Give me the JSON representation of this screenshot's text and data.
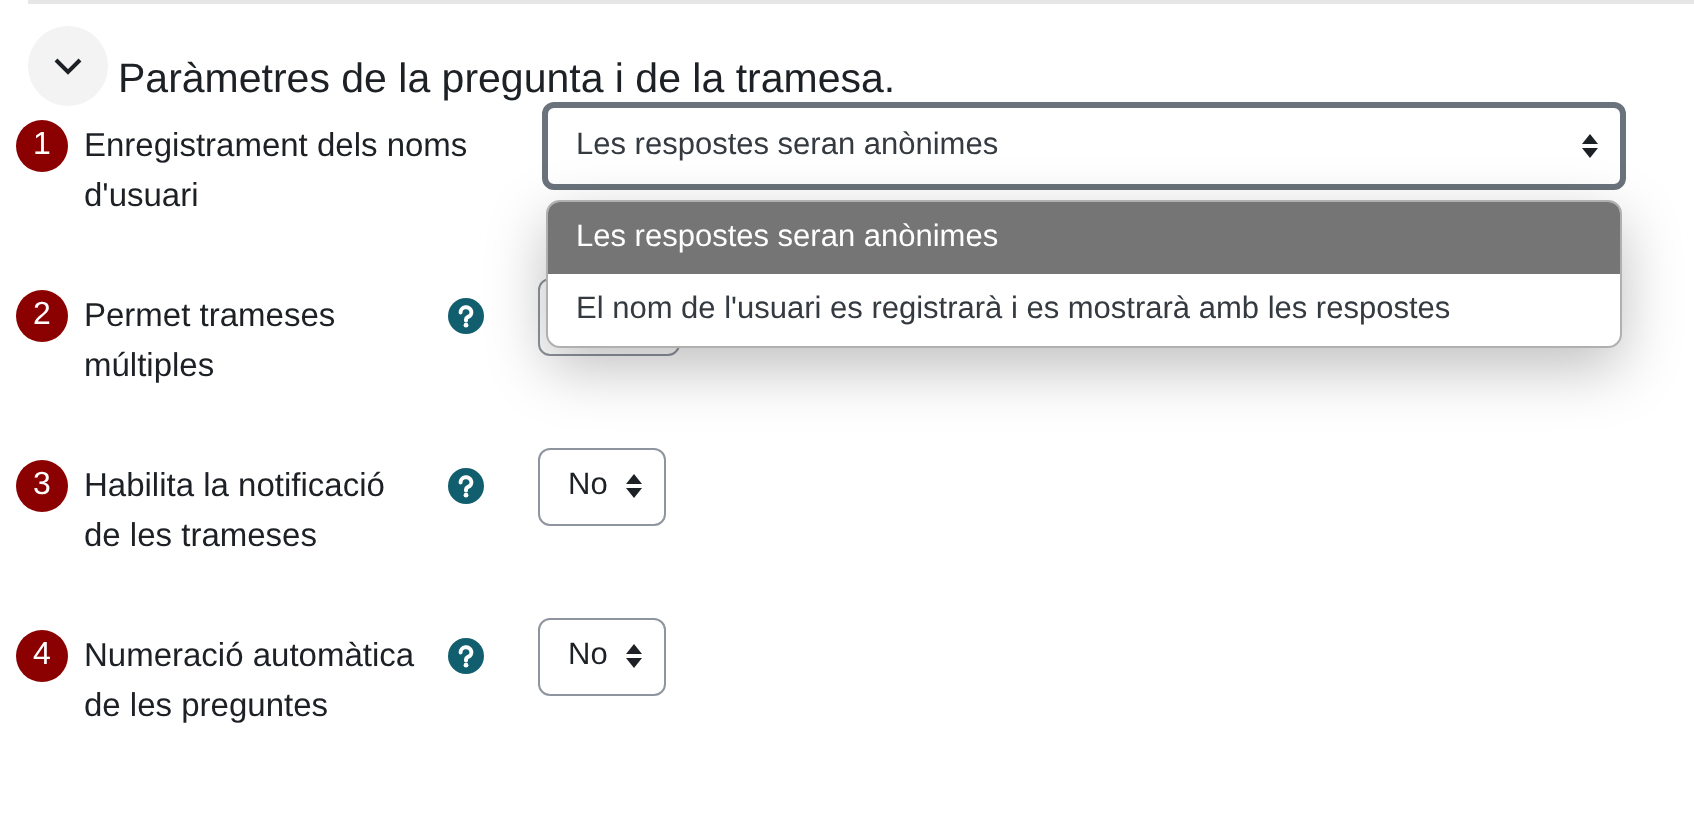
{
  "section": {
    "title": "Paràmetres de la pregunta i de la tramesa.",
    "expanded": true
  },
  "settings": [
    {
      "number": "1",
      "label": "Enregistrament dels noms d'usuari",
      "help": false,
      "focused": true,
      "value": "Les respostes seran anònimes",
      "open": true,
      "options": [
        {
          "label": "Les respostes seran anònimes",
          "selected": true
        },
        {
          "label": "El nom de l'usuari es registrarà i es mostrarà amb les respostes",
          "selected": false
        }
      ]
    },
    {
      "number": "2",
      "label": "Permet trameses múltiples",
      "help": true,
      "focused": false,
      "open": false
    },
    {
      "number": "3",
      "label": "Habilita la notificació de les trameses",
      "help": true,
      "focused": false,
      "value": "No",
      "open": false
    },
    {
      "number": "4",
      "label": "Numeració automàtica de les preguntes",
      "help": true,
      "focused": false,
      "value": "No",
      "open": false
    }
  ]
}
